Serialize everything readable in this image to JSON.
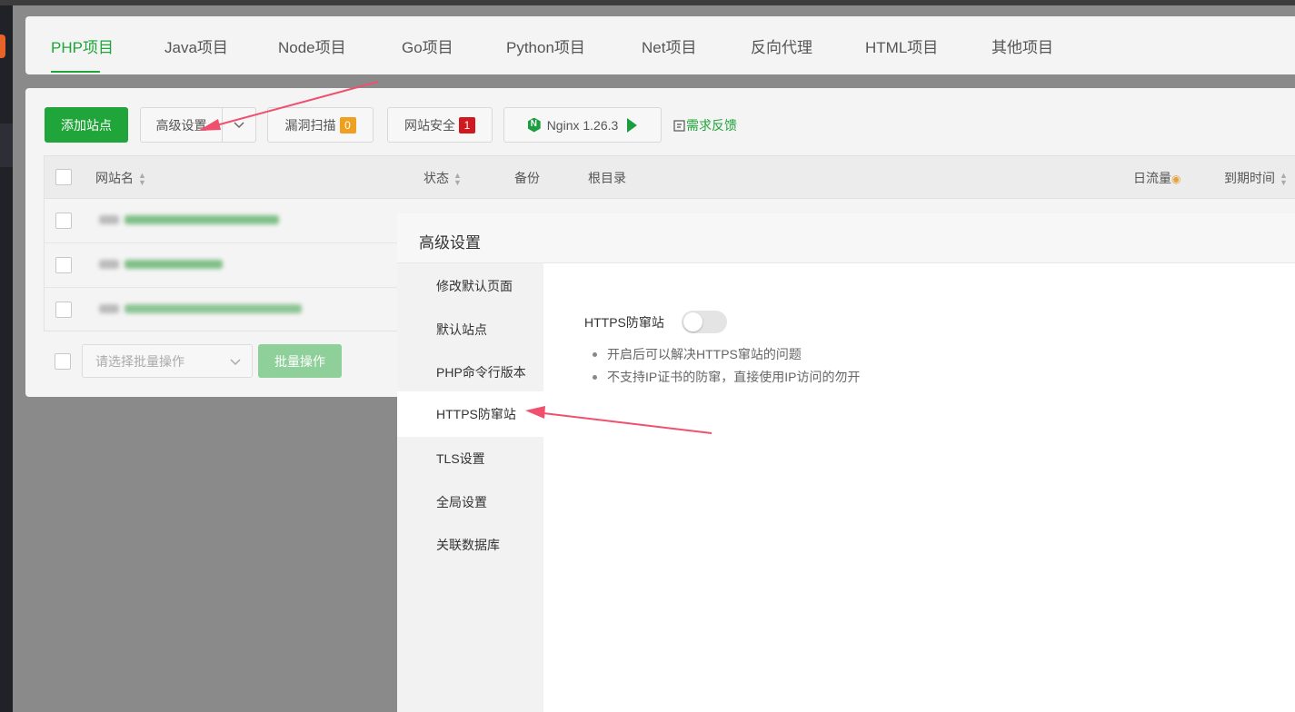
{
  "tabs": [
    "PHP项目",
    "Java项目",
    "Node项目",
    "Go项目",
    "Python项目",
    "Net项目",
    "反向代理",
    "HTML项目",
    "其他项目"
  ],
  "toolbar": {
    "add_site": "添加站点",
    "advanced": "高级设置",
    "vuln_scan": "漏洞扫描",
    "vuln_count": "0",
    "site_security": "网站安全",
    "security_count": "1",
    "nginx": "Nginx 1.26.3",
    "feedback": "需求反馈"
  },
  "table": {
    "headers": {
      "site_name": "网站名",
      "status": "状态",
      "backup": "备份",
      "root_dir": "根目录",
      "traffic": "日流量",
      "expiry": "到期时间"
    },
    "batch_placeholder": "请选择批量操作",
    "batch_button": "批量操作"
  },
  "modal": {
    "title": "高级设置",
    "menu": [
      "修改默认页面",
      "默认站点",
      "PHP命令行版本",
      "HTTPS防窜站",
      "TLS设置",
      "全局设置",
      "关联数据库"
    ],
    "active_index": 3,
    "option_label": "HTTPS防窜站",
    "toggle_on": false,
    "tips": [
      "开启后可以解决HTTPS窜站的问题",
      "不支持IP证书的防窜，直接使用IP访问的勿开"
    ]
  },
  "colors": {
    "accent": "#20a53a",
    "arrow": "#f0506e"
  }
}
